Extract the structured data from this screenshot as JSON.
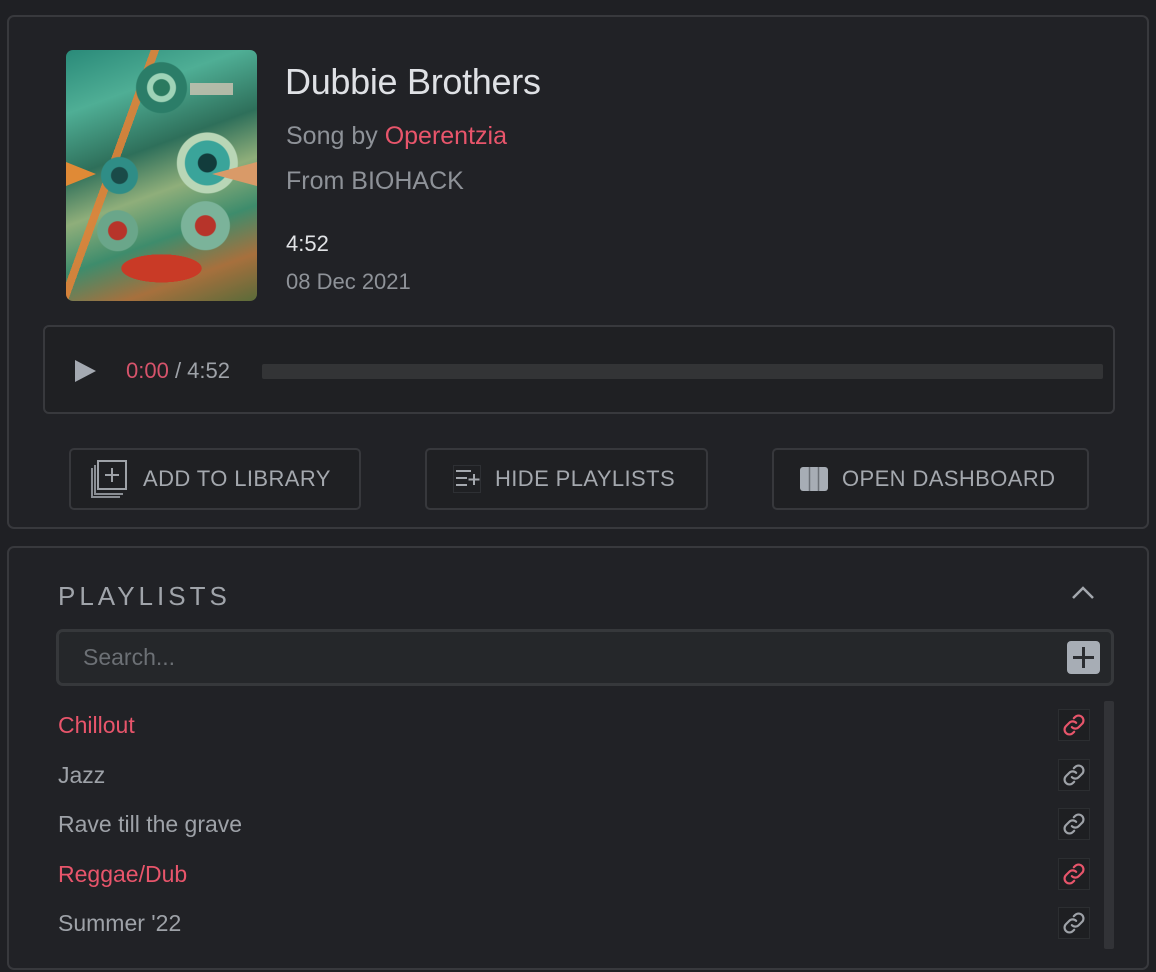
{
  "song": {
    "title": "Dubbie Brothers",
    "by_prefix": "Song by ",
    "artist": "Operentzia",
    "from": "From BIOHACK",
    "duration": "4:52",
    "date": "08 Dec 2021",
    "cover_alt": "BIOHACK album cover"
  },
  "player": {
    "current_time": "0:00",
    "separator": " / ",
    "total_time": "4:52",
    "progress_fraction": 0,
    "play_icon": "play-icon"
  },
  "actions": {
    "add_to_library": "ADD TO LIBRARY",
    "hide_playlists": "HIDE PLAYLISTS",
    "open_dashboard": "OPEN DASHBOARD"
  },
  "playlists": {
    "header": "PLAYLISTS",
    "search_placeholder": "Search...",
    "search_value": "",
    "items": [
      {
        "name": "Chillout",
        "active": true
      },
      {
        "name": "Jazz",
        "active": false
      },
      {
        "name": "Rave till the grave",
        "active": false
      },
      {
        "name": "Reggae/Dub",
        "active": true
      },
      {
        "name": "Summer '22",
        "active": false
      }
    ]
  },
  "colors": {
    "accent": "#e8556b",
    "background": "#1f2024",
    "card": "#212226",
    "border": "#38393d",
    "text_muted": "#8e9298",
    "text_primary": "#dfe1e5"
  }
}
